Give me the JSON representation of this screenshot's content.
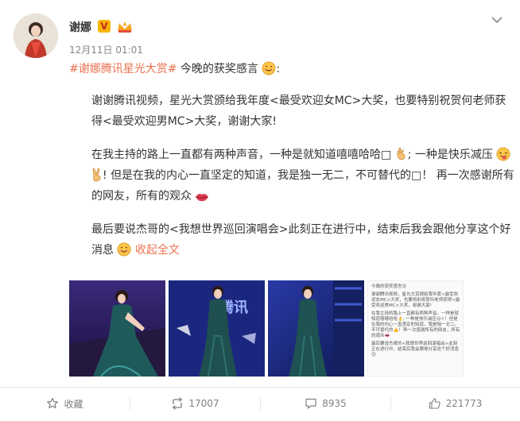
{
  "post": {
    "author": "谢娜",
    "verified_badge": "V",
    "member_icon": "member-crown-icon",
    "time": "12月11日 01:01",
    "topic": "#谢娜腾讯星光大赏#",
    "intro": " 今晚的获奖感言",
    "para1": "谢谢腾讯视频，星光大赏颁给我年度<最受欢迎女MC>大奖，也要特别祝贺何老师获得<最受欢迎男MC>大奖，谢谢大家!",
    "para2_a": "在我主持的路上一直都有两种声音，一种是就知道嘻嘻哈哈",
    "para2_b": "; 一种是快乐减压",
    "para2_c": "! 但是在我的内心一直坚定的知道，我是独一无二，不可替代的",
    "para2_d": "！ 再一次感谢所有的网友，所有的观众",
    "para3": "最后要说杰哥的<我想世界巡回演唱会>此刻正在进行中，结束后我会跟他分享这个好消息",
    "collapse_link": "收起全文",
    "glyph_box": "□"
  },
  "photos": {
    "screenshot_lines": [
      "今晚的获奖感言😊",
      "谢谢腾讯视频，星光大赏颁给我年度<最受欢迎女MC>大奖，也要特别祝贺何老师获得<最受欢迎男MC>大奖，谢谢大家!",
      "在我主持的路上一直都有两种声音，一种是就知道嘻嘻哈哈👌; 一种是快乐减压😜✌！但是在我的内心一直坚定的知道，我是独一无二，不可替代的👍！再一次感谢所有的网友，所有的观众👄",
      "最后要说杰哥的<我想世界巡回演唱会>此刻正在进行中，结束后我会跟他分享这个好消息😊"
    ],
    "stage_text": "腾讯"
  },
  "actions": {
    "favorite": "收藏",
    "repost": "17007",
    "comment": "8935",
    "like": "221773"
  },
  "colors": {
    "accent": "#eb7350",
    "text": "#333333",
    "muted": "#808080"
  }
}
